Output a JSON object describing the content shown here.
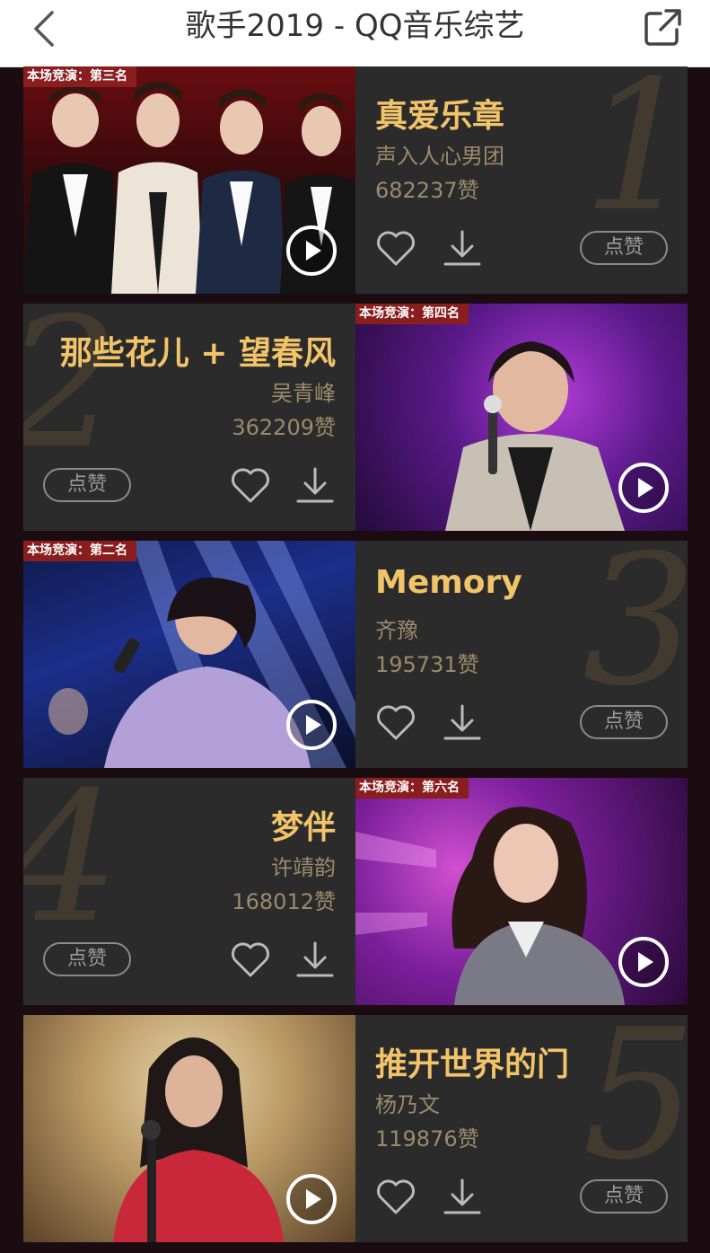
{
  "header": {
    "title": "歌手2019 - QQ音乐综艺"
  },
  "theme": {
    "accent": "#f2c46a",
    "subtle": "#9b8a6c",
    "card": "#2b2b2b",
    "ribbon": "#8a1d1d"
  },
  "items": [
    {
      "rank": "1",
      "song": "真爱乐章",
      "singer": "声入人心男团",
      "likes": "682237赞",
      "badge": "本场竞演：第三名",
      "like_button": "点赞"
    },
    {
      "rank": "2",
      "song": "那些花儿 + 望春风",
      "singer": "吴青峰",
      "likes": "362209赞",
      "badge": "本场竞演：第四名",
      "like_button": "点赞"
    },
    {
      "rank": "3",
      "song": "Memory",
      "singer": "齐豫",
      "likes": "195731赞",
      "badge": "本场竞演：第二名",
      "like_button": "点赞"
    },
    {
      "rank": "4",
      "song": "梦伴",
      "singer": "许靖韵",
      "likes": "168012赞",
      "badge": "本场竞演：第六名",
      "like_button": "点赞"
    },
    {
      "rank": "5",
      "song": "推开世界的门",
      "singer": "杨乃文",
      "likes": "119876赞",
      "badge": "",
      "like_button": "点赞"
    }
  ]
}
